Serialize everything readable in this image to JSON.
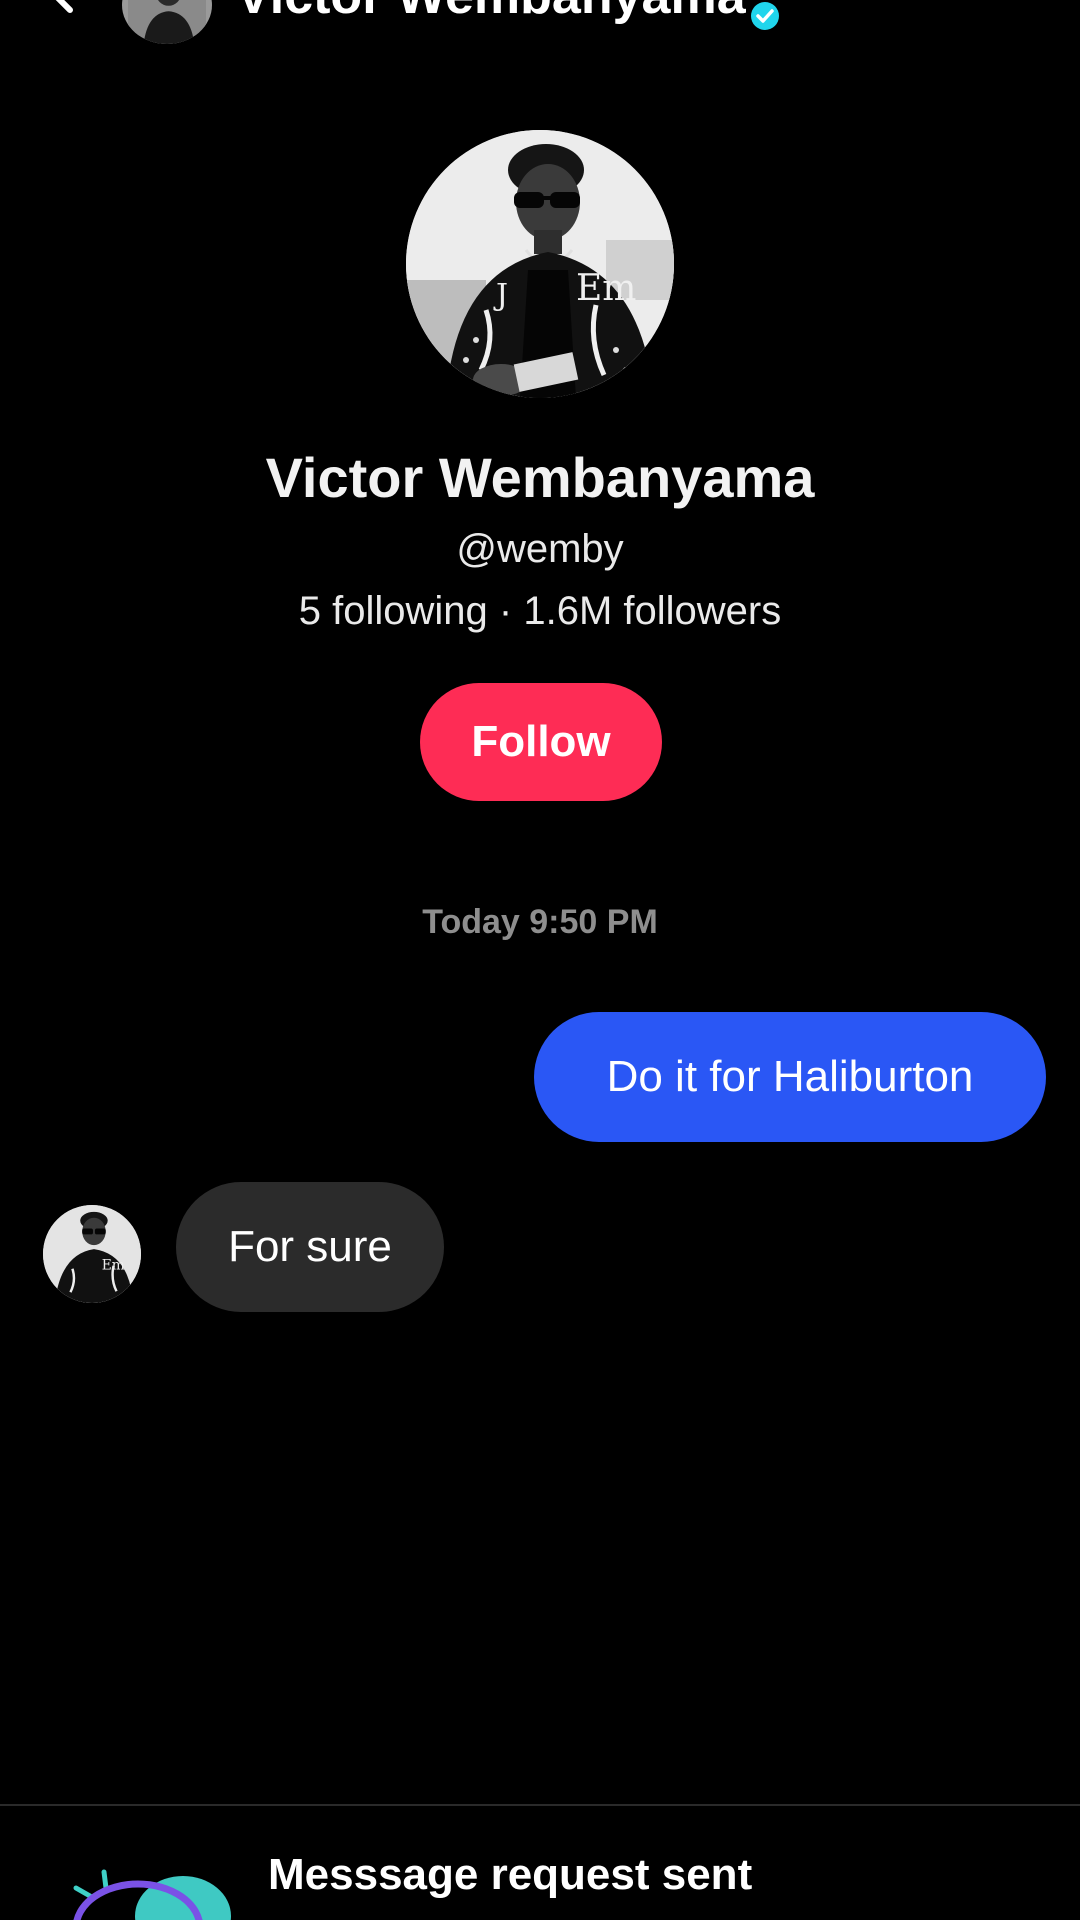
{
  "header": {
    "title": "Victor Wembanyama",
    "back_icon": "chevron-left-icon",
    "verified_icon": "verified-badge-icon",
    "more_icon": "more-dots-icon"
  },
  "profile": {
    "name": "Victor Wembanyama",
    "handle": "@wemby",
    "stats": "5 following · 1.6M followers",
    "follow_label": "Follow"
  },
  "chat": {
    "timestamp": "Today 9:50 PM",
    "messages": [
      {
        "direction": "sent",
        "text": "Do it for Haliburton"
      },
      {
        "direction": "received",
        "text": "For sure"
      }
    ]
  },
  "banner": {
    "title": "Messsage request sent",
    "icon": "message-request-icon"
  },
  "colors": {
    "background": "#000000",
    "follow_button": "#fe2c55",
    "sent_bubble": "#2a57f5",
    "received_bubble": "#2b2b2b",
    "timestamp_text": "#8e8e8e",
    "verified_badge": "#20d5ec"
  }
}
